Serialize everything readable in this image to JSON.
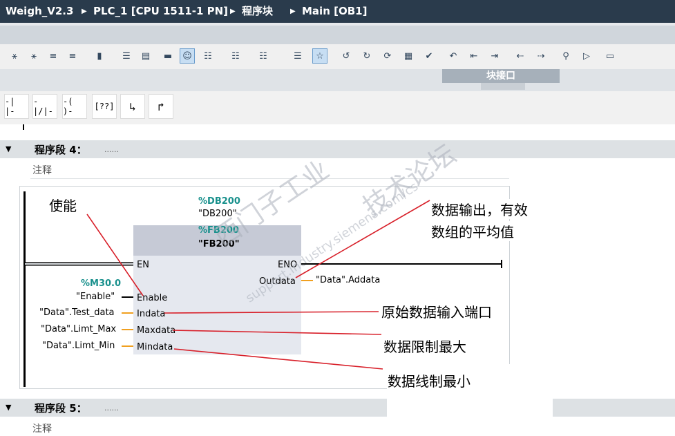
{
  "breadcrumb": {
    "project": "Weigh_V2.3",
    "device": "PLC_1 [CPU 1511-1 PN]",
    "folder": "程序块",
    "block": "Main [OB1]"
  },
  "toolbar": {
    "icons": [
      "insert-network-icon",
      "delete-network-icon",
      "insert-row-icon",
      "add-row-icon",
      "open-close-icon",
      "absolute-operands-icon",
      "show-favorites-icon",
      "show-comments-icon",
      "network-comments-icon",
      "operand-display-icon",
      "symbol-info-icon",
      "tag-info-icon",
      "navigate-icon",
      "favorites-icon",
      "goto-prev-error-icon",
      "goto-next-error-icon",
      "update-calls-icon",
      "monitoring-icon",
      "compile-icon",
      "call-environment-icon",
      "interface-left-icon",
      "interface-right-icon",
      "jump-prev-icon",
      "jump-next-icon",
      "watch-icon",
      "simulate-icon",
      "database-icon"
    ]
  },
  "interface_panel": {
    "title": "块接口"
  },
  "ladder_palette": {
    "items": [
      "-| |-",
      "-|/|-",
      "-( )-",
      "[??]",
      "↳",
      "↱"
    ]
  },
  "networks": [
    {
      "label": "程序段 4：",
      "dots": "......",
      "comment": "注释"
    },
    {
      "label": "程序段 5：",
      "dots": "......",
      "comment": "注释"
    }
  ],
  "block": {
    "db_address": "%DB200",
    "db_name": "\"DB200\"",
    "fb_address": "%FB200",
    "fb_name": "\"FB200\"",
    "en": "EN",
    "eno": "ENO",
    "inputs": [
      {
        "pin": "Enable",
        "address": "%M30.0",
        "operand": "\"Enable\""
      },
      {
        "pin": "Indata",
        "operand": "\"Data\".Test_data"
      },
      {
        "pin": "Maxdata",
        "operand": "\"Data\".Limt_Max"
      },
      {
        "pin": "Mindata",
        "operand": "\"Data\".Limt_Min"
      }
    ],
    "output": {
      "pin": "Outdata",
      "operand": "\"Data\".Addata"
    }
  },
  "annotations": {
    "enable": "使能",
    "output_line1": "数据输出，有效",
    "output_line2": "数组的平均值",
    "indata": "原始数据输入端口",
    "maxdata": "数据限制最大",
    "mindata": "数据线制最小"
  },
  "watermark": {
    "brand": "西门子工业",
    "forum": "技术论坛",
    "url": "support.industry.siemens.com/cs"
  },
  "colors": {
    "title_bar": "#2a3b4c",
    "address": "#18908c",
    "wire_orange": "#f0a020",
    "annotation_line": "#d8202a",
    "block_body": "#e5e8ef",
    "block_head": "#c6cad6"
  }
}
